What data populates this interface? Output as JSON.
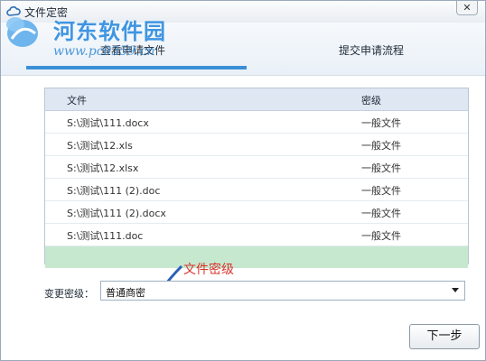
{
  "window": {
    "title": "文件定密",
    "close_glyph": "✕"
  },
  "watermark": {
    "title": "河东软件园",
    "url": "www.pc0359.cn"
  },
  "tabs": [
    {
      "label": "查看申请文件"
    },
    {
      "label": "提交申请流程"
    }
  ],
  "table": {
    "headers": [
      "文件",
      "密级"
    ],
    "rows": [
      {
        "file": "S:\\测试\\111.docx",
        "level": "一般文件"
      },
      {
        "file": "S:\\测试\\12.xls",
        "level": "一般文件"
      },
      {
        "file": "S:\\测试\\12.xlsx",
        "level": "一般文件"
      },
      {
        "file": "S:\\测试\\111 (2).doc",
        "level": "一般文件"
      },
      {
        "file": "S:\\测试\\111 (2).docx",
        "level": "一般文件"
      },
      {
        "file": "S:\\测试\\111.doc",
        "level": "一般文件"
      }
    ]
  },
  "annotation": {
    "text": "文件密级",
    "color": "#d9342b"
  },
  "level_selector": {
    "label": "变更密级：",
    "value": "普通商密"
  },
  "buttons": {
    "next": "下一步"
  },
  "colors": {
    "accent": "#3b8fd6",
    "selected_row": "#c6e8cf"
  }
}
